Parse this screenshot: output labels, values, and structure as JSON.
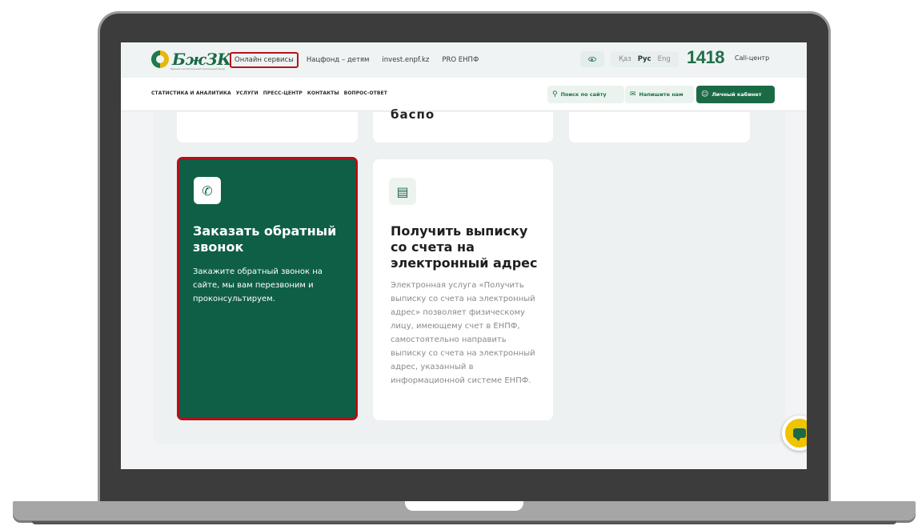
{
  "header": {
    "logo_text": "БжЗК",
    "logo_subtext": "Единый накопительный пенсионный фонд",
    "nav": [
      "Онлайн сервисы",
      "Нацфонд – детям",
      "invest.enpf.kz",
      "PRO ЕНПФ"
    ],
    "languages": [
      "Қаз",
      "Рус",
      "Eng"
    ],
    "active_language": "Рус",
    "phone": "1418",
    "call_center_label": "Call-центр"
  },
  "main_nav": [
    "СТАТИСТИКА И АНАЛИТИКА",
    "УСЛУГИ",
    "ПРЕСС-ЦЕНТР",
    "КОНТАКТЫ",
    "ВОПРОС-ОТВЕТ"
  ],
  "actions": {
    "search": "Поиск по сайту",
    "write": "Напишите нам",
    "cabinet": "Личный кабинет"
  },
  "cards": {
    "prev_partial_text": "баспо",
    "callback": {
      "title": "Заказать обратный звонок",
      "description": "Закажите обратный звонок на сайте, мы вам перезвоним и проконсультируем.",
      "icon": "phone-icon"
    },
    "statement": {
      "title": "Получить выписку со счета на электронный адрес",
      "description": "Электронная услуга «Получить выписку со счета на электронный адрес» позволяет физическому лицу, имеющему счет в ЕНПФ, самостоятельно направить выписку со счета на электронный адрес, указанный в информационной системе ЕНПФ.",
      "icon": "document-icon"
    }
  },
  "colors": {
    "brand_green": "#1b6a46",
    "card_green": "#0f5f46",
    "highlight_red": "#b30f17",
    "brand_yellow": "#f0c400"
  }
}
